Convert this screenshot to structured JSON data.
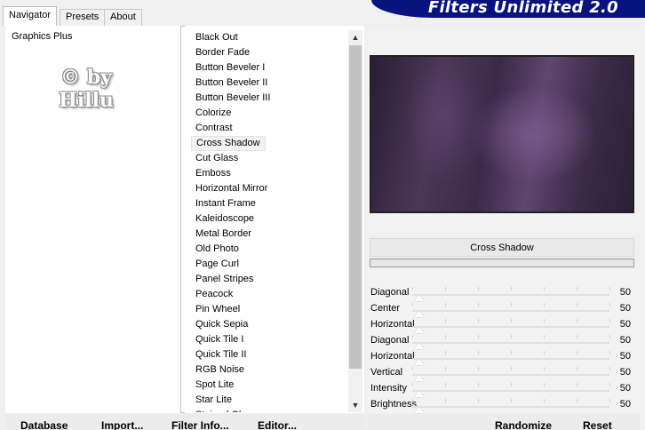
{
  "tabs": [
    "Navigator",
    "Presets",
    "About"
  ],
  "banner_title": "Filters Unlimited 2.0",
  "categories": [
    "Graphics Plus"
  ],
  "watermark": [
    "© by",
    "Hillu"
  ],
  "filters": [
    "Black Out",
    "Border Fade",
    "Button Beveler I",
    "Button Beveler II",
    "Button Beveler III",
    "Colorize",
    "Contrast",
    "Cross Shadow",
    "Cut Glass",
    "Emboss",
    "Horizontal Mirror",
    "Instant Frame",
    "Kaleidoscope",
    "Metal Border",
    "Old Photo",
    "Page Curl",
    "Panel Stripes",
    "Peacock",
    "Pin Wheel",
    "Quick Sepia",
    "Quick Tile I",
    "Quick Tile II",
    "RGB Noise",
    "Spot Lite",
    "Star Lite",
    "Stained Glass"
  ],
  "selected_filter": "Cross Shadow",
  "filter_name": "Cross Shadow",
  "params": [
    {
      "label": "Diagonal",
      "value": "50"
    },
    {
      "label": "Center",
      "value": "50"
    },
    {
      "label": "Horizontal",
      "value": "50"
    },
    {
      "label": "Diagonal",
      "value": "50"
    },
    {
      "label": "Horizontal",
      "value": "50"
    },
    {
      "label": "Vertical",
      "value": "50"
    },
    {
      "label": "Intensity",
      "value": "50"
    },
    {
      "label": "Brightness",
      "value": "50"
    }
  ],
  "buttons": {
    "database": "Database",
    "import": "Import...",
    "filter_info": "Filter Info...",
    "editor": "Editor...",
    "randomize": "Randomize",
    "reset": "Reset"
  },
  "icons": {
    "scroll_up": "chevron-up-icon",
    "scroll_down": "chevron-down-icon"
  },
  "colors": {
    "banner": "#08137e",
    "preview_dark": "#2a1e33",
    "preview_light": "#7a588c"
  }
}
